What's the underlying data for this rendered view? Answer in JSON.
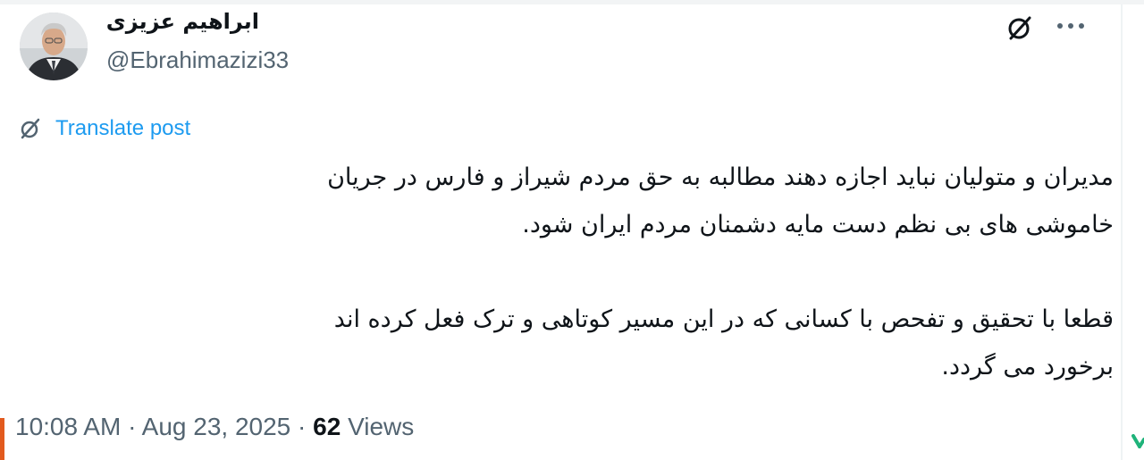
{
  "author": {
    "display_name": "ابراهیم عزیزی",
    "handle": "@Ebrahimazizi33"
  },
  "actions": {
    "grok_icon": "grok-slashed-circle-icon",
    "more_icon": "more-horizontal-icon",
    "more_label": "···"
  },
  "translate": {
    "label": "Translate post",
    "icon": "translate-slashed-circle-icon"
  },
  "tweet": {
    "paragraph_1_line_1": "مدیران و متولیان نباید اجازه دهند مطالبه به حق مردم شیراز و فارس در جریان",
    "paragraph_1_line_2": "خاموشی های بی نظم دست مایه دشمنان مردم ایران شود.",
    "paragraph_2_line_1": "قطعا با تحقیق و تفحص با کسانی که در این مسیر کوتاهی و ترک فعل کرده اند",
    "paragraph_2_line_2": "برخورد می گردد."
  },
  "meta": {
    "time": "10:08 AM",
    "separator": " · ",
    "date": "Aug 23, 2025",
    "views_count": "62",
    "views_label": "Views"
  },
  "colors": {
    "text": "#0f1419",
    "secondary": "#536471",
    "link": "#1d9bf0",
    "accent_left": "#e25a1e",
    "accent_right": "#1fb37a"
  }
}
